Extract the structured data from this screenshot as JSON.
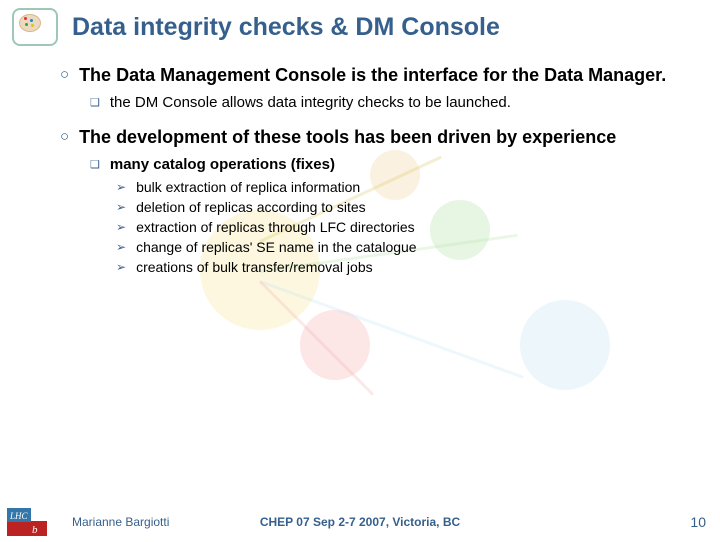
{
  "title": "Data integrity checks & DM Console",
  "bullets": [
    {
      "text": "The Data Management Console is the interface for the Data Manager.",
      "sub": [
        {
          "text": "the DM Console allows data integrity checks to be launched.",
          "bold": false
        }
      ]
    },
    {
      "text": "The development of these tools has been driven by experience",
      "sub": [
        {
          "text": "many catalog operations (fixes)",
          "bold": true,
          "sub": [
            "bulk extraction of replica information",
            "deletion of replicas according to sites",
            "extraction of replicas through LFC directories",
            "change of replicas' SE name in the catalogue",
            "creations of bulk transfer/removal jobs"
          ]
        }
      ]
    }
  ],
  "footer": {
    "author": "Marianne Bargiotti",
    "conference": "CHEP 07 Sep 2-7 2007, Victoria, BC",
    "page": "10"
  }
}
